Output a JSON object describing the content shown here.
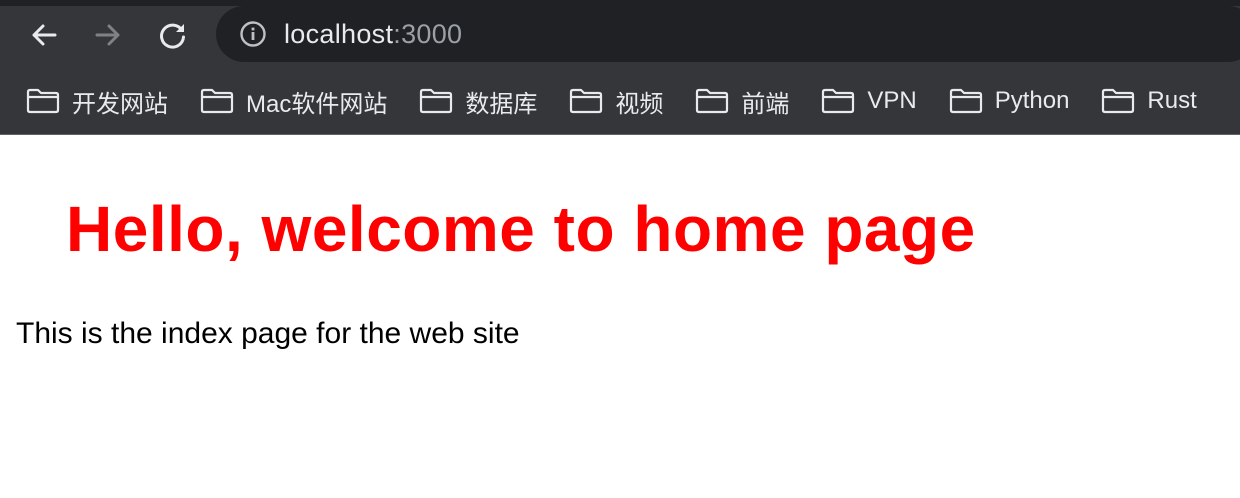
{
  "browser": {
    "url": {
      "host": "localhost",
      "port": ":3000"
    },
    "nav": {
      "back_icon": "arrow-left-icon",
      "forward_icon": "arrow-right-icon",
      "reload_icon": "reload-icon",
      "info_icon": "info-icon"
    },
    "bookmarks": [
      {
        "label": "开发网站",
        "icon": "folder-icon"
      },
      {
        "label": "Mac软件网站",
        "icon": "folder-icon"
      },
      {
        "label": "数据库",
        "icon": "folder-icon"
      },
      {
        "label": "视频",
        "icon": "folder-icon"
      },
      {
        "label": "前端",
        "icon": "folder-icon"
      },
      {
        "label": "VPN",
        "icon": "folder-icon"
      },
      {
        "label": "Python",
        "icon": "folder-icon"
      },
      {
        "label": "Rust",
        "icon": "folder-icon"
      }
    ],
    "colors": {
      "chrome_bg": "#35363a",
      "omnibox_bg": "#202124",
      "text": "#e8eaed",
      "muted_text": "#9aa0a6"
    }
  },
  "page": {
    "heading": "Hello, welcome to home page",
    "paragraph": "This is the index page for the web site",
    "colors": {
      "heading": "#ff0000",
      "paragraph": "#000000",
      "background": "#ffffff"
    }
  }
}
